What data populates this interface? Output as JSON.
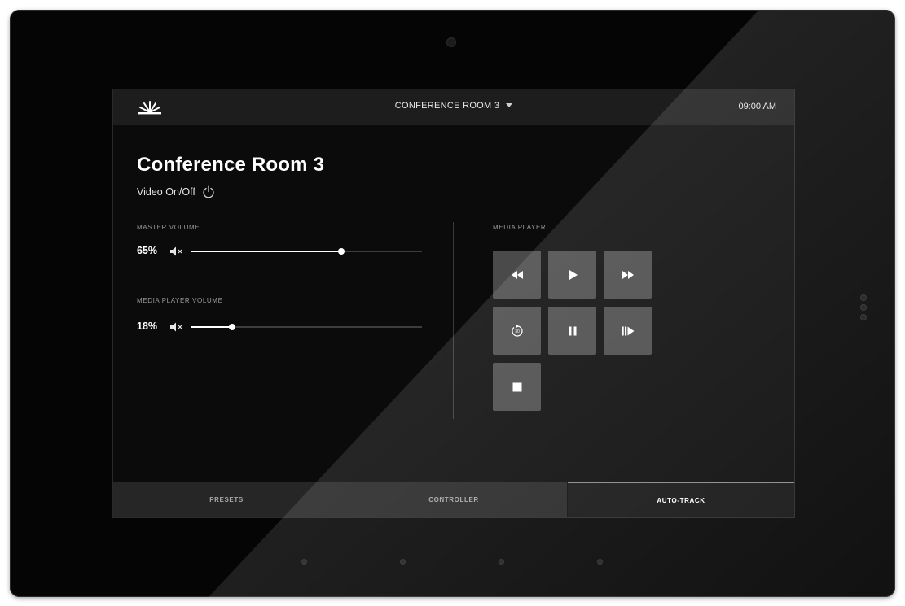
{
  "header": {
    "room_select_label": "CONFERENCE ROOM 3",
    "clock": "09:00 AM",
    "logo_icon": "sunburst-logo-icon"
  },
  "main": {
    "title": "Conference Room 3",
    "video_toggle_label": "Video On/Off",
    "video_toggle_icon": "power-icon"
  },
  "master_volume": {
    "label": "MASTER VOLUME",
    "percent_text": "65%",
    "level": 0.65,
    "mute_icon": "speaker-mute-icon"
  },
  "media_player_volume": {
    "label": "MEDIA PLAYER VOLUME",
    "percent_text": "18%",
    "level": 0.18,
    "mute_icon": "speaker-mute-icon"
  },
  "media_player": {
    "label": "MEDIA PLAYER",
    "buttons": [
      {
        "icon": "rewind-icon"
      },
      {
        "icon": "play-icon"
      },
      {
        "icon": "fast-forward-icon"
      },
      {
        "icon": "replay-30-icon",
        "text": "30"
      },
      {
        "icon": "pause-icon"
      },
      {
        "icon": "step-forward-icon"
      },
      {
        "icon": "stop-icon"
      }
    ]
  },
  "tabs": [
    {
      "label": "PRESETS",
      "active": false
    },
    {
      "label": "CONTROLLER",
      "active": false
    },
    {
      "label": "AUTO-TRACK",
      "active": true
    }
  ],
  "colors": {
    "screen_bg": "#0b0b0b",
    "topbar_bg": "#1d1d1d",
    "button_bg": "#4a4a4a",
    "accent": "#ffffff"
  }
}
